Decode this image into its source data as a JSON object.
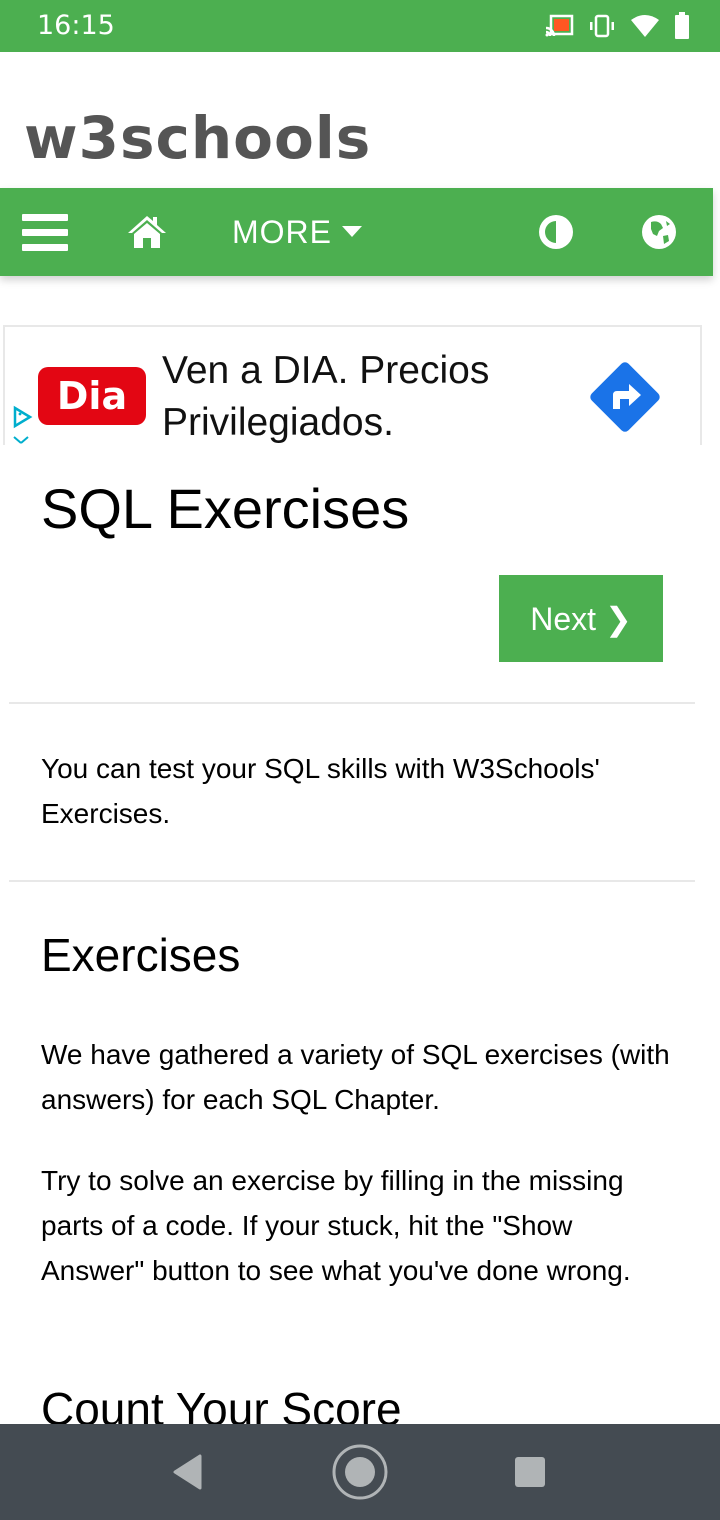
{
  "status_bar": {
    "time": "16:15",
    "icons": [
      "cast-icon",
      "vibrate-icon",
      "wifi-icon",
      "battery-icon"
    ]
  },
  "header": {
    "logo": "w3schools"
  },
  "topnav": {
    "menu_icon": "hamburger-icon",
    "home_icon": "home-icon",
    "more_label": "MORE",
    "contrast_icon": "contrast-icon",
    "globe_icon": "globe-icon"
  },
  "ad": {
    "brand": "Dia",
    "line1": "Ven a DIA. Precios",
    "line2": "Privilegiados.",
    "colors": {
      "brand_red": "#e30613",
      "arrow_blue": "#1a73e8"
    }
  },
  "main": {
    "title": "SQL Exercises",
    "next_button": "Next ❯",
    "intro": "You can test your SQL skills with W3Schools' Exercises.",
    "section_heading": "Exercises",
    "para1": "We have gathered a variety of SQL exercises (with answers) for each SQL Chapter.",
    "para2": "Try to solve an exercise by filling in the missing parts of a code. If your stuck, hit the \"Show Answer\" button to see what you've done wrong.",
    "section_heading2": "Count Your Score"
  },
  "colors": {
    "accent_green": "#4caf50",
    "system_nav": "#444b52"
  }
}
